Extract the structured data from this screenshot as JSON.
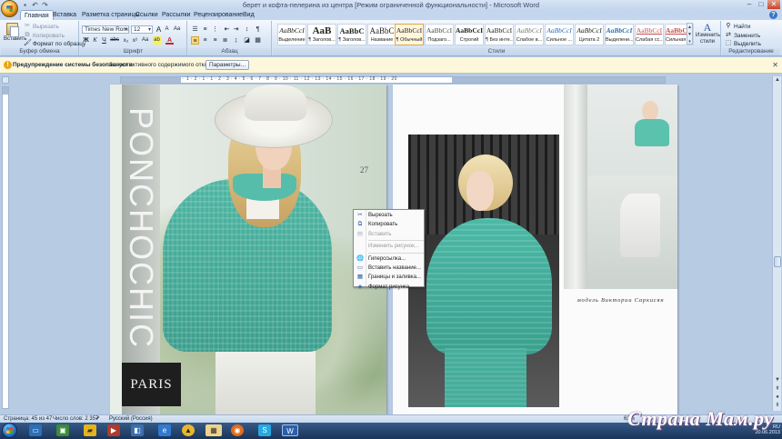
{
  "window": {
    "title": "берет и кофта-пелерина из центра [Режим ограниченной функциональности] - Microsoft Word",
    "qat": [
      "save-icon",
      "undo-icon",
      "redo-icon"
    ]
  },
  "tabs": [
    "Главная",
    "Вставка",
    "Разметка страницы",
    "Ссылки",
    "Рассылки",
    "Рецензирование",
    "Вид"
  ],
  "ribbon": {
    "clipboard": {
      "label": "Буфер обмена",
      "paste": "Вставить",
      "cut": "Вырезать",
      "copy": "Копировать",
      "format_painter": "Формат по образцу"
    },
    "font": {
      "label": "Шрифт",
      "name": "Times New Roman",
      "size": "12",
      "grow": "A",
      "shrink": "A",
      "clear": "Aa",
      "bold": "Ж",
      "italic": "К",
      "underline": "Ч",
      "strike": "abc",
      "sub": "x₂",
      "sup": "x²",
      "case": "Aa",
      "highlight": "ab",
      "color": "A"
    },
    "paragraph": {
      "label": "Абзац"
    },
    "styles": {
      "label": "Стили",
      "items": [
        {
          "sample": "AaBbCcI",
          "name": "Выделение"
        },
        {
          "sample": "AaB",
          "name": "¶ Заголов..."
        },
        {
          "sample": "AaBbC",
          "name": "¶ Заголов..."
        },
        {
          "sample": "AaBbC",
          "name": "Название"
        },
        {
          "sample": "AaBbCcI",
          "name": "¶ Обычный"
        },
        {
          "sample": "AaBbCcI",
          "name": "Подзаго..."
        },
        {
          "sample": "AaBbCcI",
          "name": "Строгий"
        },
        {
          "sample": "AaBbCcI",
          "name": "¶ Без инте..."
        },
        {
          "sample": "AaBbCcI",
          "name": "Слабое в..."
        },
        {
          "sample": "AaBbCcI",
          "name": "Сильное ..."
        },
        {
          "sample": "AaBbCcI",
          "name": "Цитата 2"
        },
        {
          "sample": "AaBbCcI",
          "name": "Выделени..."
        },
        {
          "sample": "AaBbCcI",
          "name": "Слабая сс..."
        },
        {
          "sample": "AaBbCcI",
          "name": "Сильная с..."
        }
      ],
      "change": "Изменить стили"
    },
    "editing": {
      "label": "Редактирование",
      "find": "Найти",
      "replace": "Заменить",
      "select": "Выделить"
    }
  },
  "security_bar": {
    "title": "Предупреждение системы безопасности",
    "message": "Запуск активного содержимого отключен.",
    "button": "Параметры..."
  },
  "ruler": {
    "ticks": "· 1 · 2 · 1 · 1 · 2 · 3 · 4 · 5 · 6 · 7 · 8 · 9 · 10 · 11 · 12 · 13 · 14 · 15 · 16 · 17 · 18 · 19 · 20"
  },
  "document": {
    "vertical_title": "PONCHOCHIC",
    "page_number": "27",
    "paris": "PARIS",
    "caption": "модель Виктории Саркисян"
  },
  "context_menu": {
    "items": [
      {
        "label": "Вырезать",
        "icon": "cut-icon",
        "enabled": true
      },
      {
        "label": "Копировать",
        "icon": "copy-icon",
        "enabled": true
      },
      {
        "label": "Вставить",
        "icon": "paste-icon",
        "enabled": false
      },
      {
        "label": "Изменить рисунок...",
        "icon": "",
        "enabled": false
      },
      {
        "label": "Гиперссылка...",
        "icon": "hyperlink-icon",
        "enabled": true
      },
      {
        "label": "Вставить название...",
        "icon": "caption-icon",
        "enabled": true
      },
      {
        "label": "Границы и заливка...",
        "icon": "borders-icon",
        "enabled": true
      },
      {
        "label": "Формат рисунка...",
        "icon": "format-picture-icon",
        "enabled": true
      }
    ]
  },
  "status": {
    "page": "Страница: 45 из 47",
    "words": "Число слов: 2 357",
    "language": "Русский (Россия)",
    "zoom": "63%"
  },
  "taskbar": {
    "tray_lang": "RU",
    "tray_date": "20.06.2013"
  },
  "watermark": "Страна Мам.ру"
}
